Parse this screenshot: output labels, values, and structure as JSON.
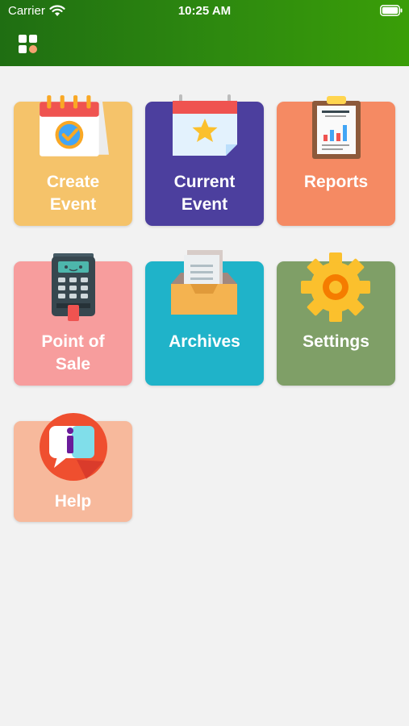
{
  "status_bar": {
    "carrier": "Carrier",
    "time": "10:25 AM"
  },
  "colors": {
    "header_start": "#1f6e12",
    "header_end": "#3a9e08",
    "background": "#f2f2f2"
  },
  "tiles": [
    {
      "label": "Create\nEvent",
      "icon": "calendar-check-icon",
      "color": "#f5c36a"
    },
    {
      "label": "Current\nEvent",
      "icon": "calendar-star-icon",
      "color": "#4c3f9e"
    },
    {
      "label": "Reports",
      "icon": "clipboard-chart-icon",
      "color": "#f58a63"
    },
    {
      "label": "Point of\nSale",
      "icon": "card-terminal-icon",
      "color": "#f79d9d"
    },
    {
      "label": "Archives",
      "icon": "archive-box-icon",
      "color": "#1fb3c9"
    },
    {
      "label": "Settings",
      "icon": "gear-icon",
      "color": "#7f9f67"
    },
    {
      "label": "Help",
      "icon": "info-bubble-icon",
      "color": "#f7b99c"
    }
  ]
}
